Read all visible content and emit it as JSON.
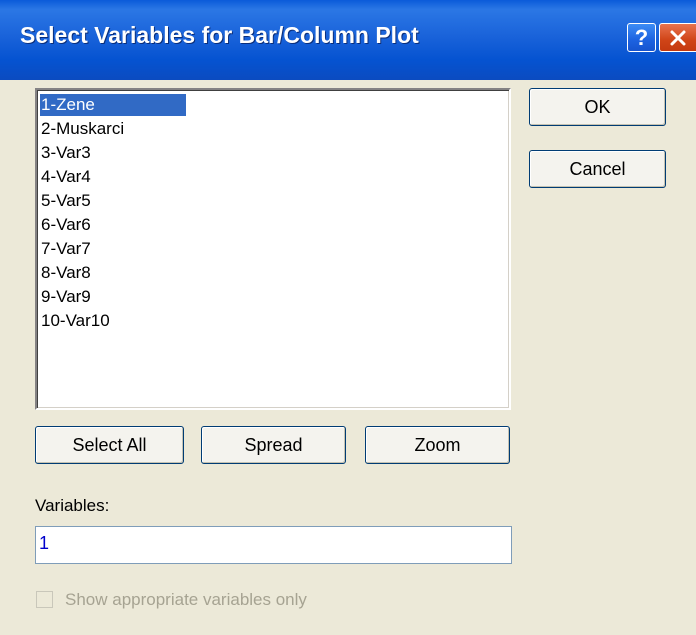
{
  "window": {
    "title": "Select Variables for Bar/Column Plot",
    "help_label": "?"
  },
  "list": {
    "items": [
      {
        "label": "1-Zene",
        "selected": true
      },
      {
        "label": "2-Muskarci",
        "selected": false
      },
      {
        "label": "3-Var3",
        "selected": false
      },
      {
        "label": "4-Var4",
        "selected": false
      },
      {
        "label": "5-Var5",
        "selected": false
      },
      {
        "label": "6-Var6",
        "selected": false
      },
      {
        "label": "7-Var7",
        "selected": false
      },
      {
        "label": "8-Var8",
        "selected": false
      },
      {
        "label": "9-Var9",
        "selected": false
      },
      {
        "label": "10-Var10",
        "selected": false
      }
    ]
  },
  "buttons": {
    "ok": "OK",
    "cancel": "Cancel",
    "select_all": "Select All",
    "spread": "Spread",
    "zoom": "Zoom"
  },
  "variables": {
    "label": "Variables:",
    "value": "1"
  },
  "options": {
    "show_appropriate_label": "Show appropriate variables only",
    "show_appropriate_checked": false,
    "show_appropriate_enabled": false
  },
  "colors": {
    "titlebar": "#0553D1",
    "selection": "#316AC5",
    "dialog_bg": "#ECE9D8"
  }
}
